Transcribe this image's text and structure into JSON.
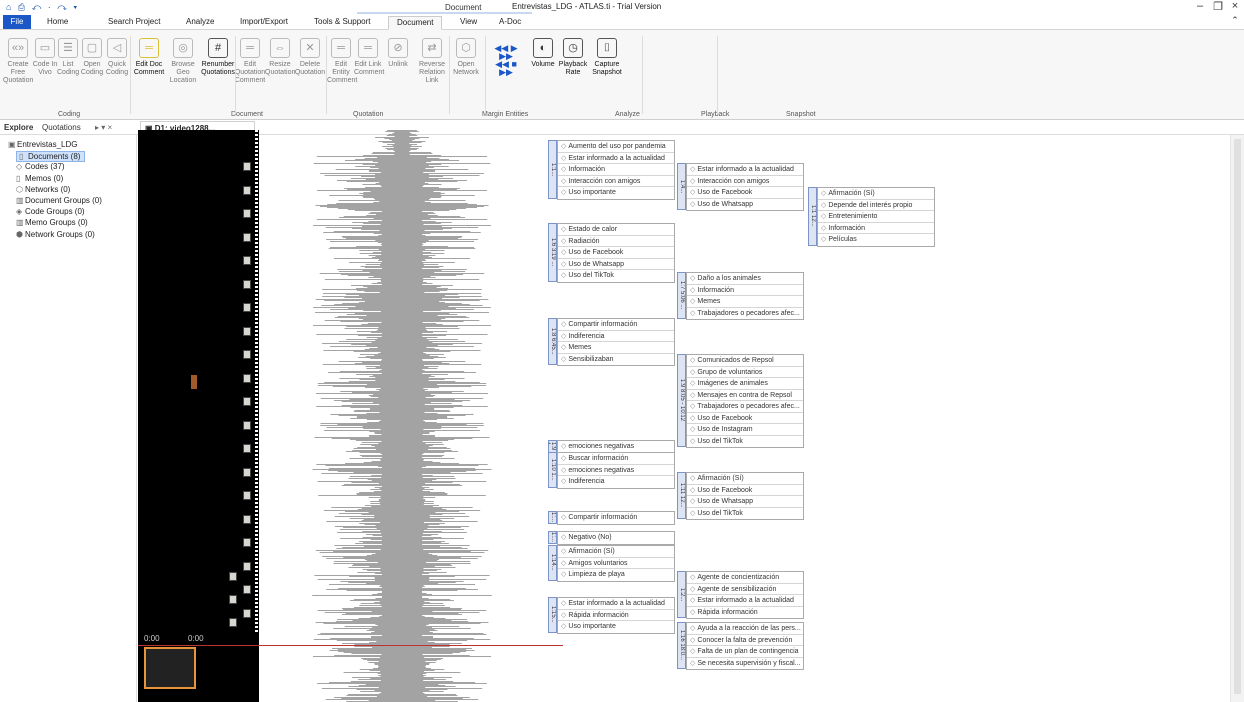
{
  "app": {
    "window_title": "Entrevistas_LDG - ATLAS.ti - Trial Version",
    "context_tab_label": "Document",
    "quick_access": "⌂ ⎙ ↶ · ↷ ▾"
  },
  "menu_tabs": [
    "File",
    "Home",
    "Search Project",
    "Analyze",
    "Import/Export",
    "Tools & Support",
    "Document",
    "View",
    "A-Doc"
  ],
  "ribbon": {
    "buttons": [
      {
        "label": "Create Free\nQuotation",
        "icon": "quote-icon",
        "active": false
      },
      {
        "label": "Code In\nVivo",
        "icon": "vivo-icon",
        "active": false
      },
      {
        "label": "List\nCoding",
        "icon": "list-icon",
        "active": false
      },
      {
        "label": "Open\nCoding",
        "icon": "open-icon",
        "active": false
      },
      {
        "label": "Quick\nCoding",
        "icon": "quick-icon",
        "active": false
      },
      {
        "label": "Edit Doc\nComment",
        "icon": "comment-icon",
        "active": true
      },
      {
        "label": "Browse Geo\nLocation",
        "icon": "geo-icon",
        "active": false
      },
      {
        "label": "Renumber\nQuotations",
        "icon": "hash-icon",
        "active": true
      },
      {
        "label": "Edit Quotation\nComment",
        "icon": "edit-quote-icon",
        "active": false
      },
      {
        "label": "Resize\nQuotation",
        "icon": "resize-icon",
        "active": false
      },
      {
        "label": "Delete\nQuotation",
        "icon": "delete-icon",
        "active": false
      },
      {
        "label": "Edit Entity\nComment",
        "icon": "entity-icon",
        "active": false
      },
      {
        "label": "Edit Link\nComment",
        "icon": "link-icon",
        "active": false
      },
      {
        "label": "Unlink",
        "icon": "unlink-icon",
        "active": false
      },
      {
        "label": "Reverse Relation\nLink",
        "icon": "reverse-icon",
        "active": false
      },
      {
        "label": "Open\nNetwork",
        "icon": "network-icon",
        "active": false
      },
      {
        "label": "Volume",
        "icon": "volume-icon",
        "active": true
      },
      {
        "label": "Playback\nRate",
        "icon": "playback-icon",
        "active": true
      },
      {
        "label": "Capture\nSnapshot",
        "icon": "camera-icon",
        "active": true
      }
    ],
    "groups": [
      "Coding",
      "Document",
      "Quotation",
      "Margin Entities",
      "Analyze",
      "Playback",
      "Snapshot"
    ],
    "media_controls": "◀◀ ▶ ▶▶\n◀◀ ■ ▶▶"
  },
  "panes": {
    "explore_tab": "Explore",
    "quotations_tab": "Quotations",
    "doc_tab": "D1: video1288..."
  },
  "navigator": [
    {
      "label": "Entrevistas_LDG",
      "icon": "project-icon",
      "selected": false
    },
    {
      "label": "Documents (8)",
      "icon": "document-icon",
      "selected": true
    },
    {
      "label": "Codes (37)",
      "icon": "code-icon",
      "selected": false
    },
    {
      "label": "Memos (0)",
      "icon": "memo-icon",
      "selected": false
    },
    {
      "label": "Networks (0)",
      "icon": "network-icon",
      "selected": false
    },
    {
      "label": "Document Groups (0)",
      "icon": "doc-group-icon",
      "selected": false
    },
    {
      "label": "Code Groups (0)",
      "icon": "code-group-icon",
      "selected": false
    },
    {
      "label": "Memo Groups (0)",
      "icon": "memo-group-icon",
      "selected": false
    },
    {
      "label": "Network Groups (0)",
      "icon": "network-group-icon",
      "selected": false
    }
  ],
  "video_timeline": {
    "start": "0:00",
    "mark": "0:00"
  },
  "margin": [
    {
      "quote": "1:1...",
      "codes": [
        "Aumento del uso por pandemia",
        "Estar informado a la actualidad",
        "Información",
        "Interacción con amigos",
        "Uso importante"
      ]
    },
    {
      "quote": "1:4...",
      "codes": [
        "Estar informado a la actualidad",
        "Interacción con amigos",
        "Uso de Facebook",
        "Uso de Whatsapp"
      ]
    },
    {
      "quote": "1:1 12...",
      "codes": [
        "Afirmación (Sí)",
        "Depende del interés propio",
        "Entretenimiento",
        "Información",
        "Películas"
      ]
    },
    {
      "quote": "1:6 3:19 ...",
      "codes": [
        "Estado de calor",
        "Radiación",
        "Uso de Facebook",
        "Uso de Whatsapp",
        "Uso del TikTok"
      ]
    },
    {
      "quote": "1:7 5:06 ...",
      "codes": [
        "Daño a los animales",
        "Información",
        "Memes",
        "Trabajadores o pecadores afec..."
      ]
    },
    {
      "quote": "1:8 6:45...",
      "codes": [
        "Compartir información",
        "Indiferencia",
        "Memes",
        "Sensibilizaban"
      ]
    },
    {
      "quote": "1:9 8:05 - 10:12",
      "codes": [
        "Comunicados de Repsol",
        "Grupo de voluntarios",
        "Imágenes de animales",
        "Mensajes en contra de Repsol",
        "Trabajadores o pecadores afec...",
        "Uso de Facebook",
        "Uso de Instagram",
        "Uso del TikTok"
      ]
    },
    {
      "quote": "1:9 1...",
      "codes": [
        "emociones negativas"
      ]
    },
    {
      "quote": "1:10 1...",
      "codes": [
        "Buscar información",
        "emociones negativas",
        "Indiferencia"
      ]
    },
    {
      "quote": "1:11 12...",
      "codes": [
        "Afirmación (Sí)",
        "Uso de Facebook",
        "Uso de Whatsapp",
        "Uso del TikTok"
      ]
    },
    {
      "quote": "1:...",
      "codes": [
        "Compartir información"
      ]
    },
    {
      "quote": "1:...",
      "codes": [
        "Negativo (No)"
      ]
    },
    {
      "quote": "1:14...",
      "codes": [
        "Afirmación (Sí)",
        "Amigos voluntarios",
        "Limpieza de playa"
      ]
    },
    {
      "quote": "1:2...",
      "codes": [
        "Agente de concientización",
        "Agente de sensibilización",
        "Estar informado a la actualidad",
        "Rápida información"
      ]
    },
    {
      "quote": "1:15...",
      "codes": [
        "Estar informado a la actualidad",
        "Rápida información",
        "Uso importante"
      ]
    },
    {
      "quote": "1:16 18:0...",
      "codes": [
        "Ayuda a la reacción de las pers...",
        "Conocer la falta de prevención",
        "Falta de un plan de contingencia",
        "Se necesita supervisión y fiscal..."
      ]
    }
  ],
  "colors": {
    "accent": "#1b57c7",
    "selection": "#cfe2fb",
    "timeline_window": "#e8943a",
    "quotation_bar": "#7b93c8"
  }
}
